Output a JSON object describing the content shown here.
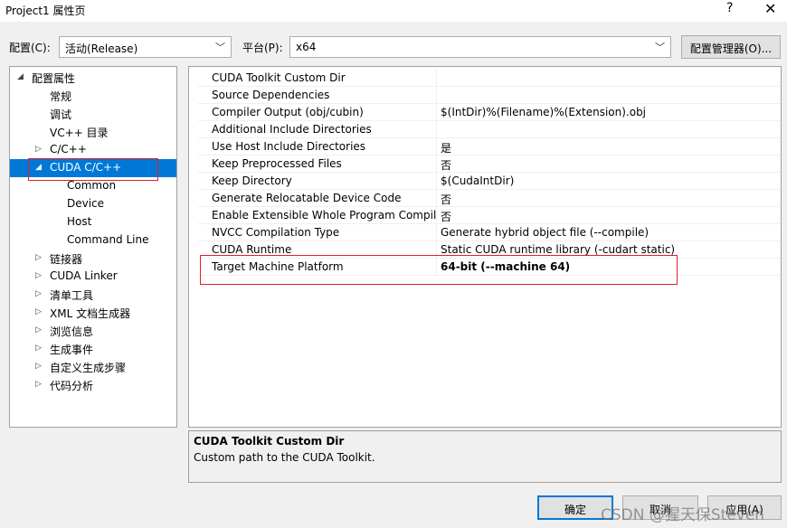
{
  "window": {
    "title": "Project1 属性页",
    "help_label": "?",
    "close_label": "✕"
  },
  "toolbar": {
    "config_label": "配置(C):",
    "config_value": "活动(Release)",
    "platform_label": "平台(P):",
    "platform_value": "x64",
    "config_manager_label": "配置管理器(O)..."
  },
  "tree": {
    "items": [
      {
        "label": "配置属性",
        "expander": "◢"
      },
      {
        "label": "常规",
        "expander": ""
      },
      {
        "label": "调试",
        "expander": ""
      },
      {
        "label": "VC++ 目录",
        "expander": ""
      },
      {
        "label": "C/C++",
        "expander": "▷"
      },
      {
        "label": "CUDA C/C++",
        "expander": "◢"
      },
      {
        "label": "Common",
        "expander": ""
      },
      {
        "label": "Device",
        "expander": ""
      },
      {
        "label": "Host",
        "expander": ""
      },
      {
        "label": "Command Line",
        "expander": ""
      },
      {
        "label": "链接器",
        "expander": "▷"
      },
      {
        "label": "CUDA Linker",
        "expander": "▷"
      },
      {
        "label": "清单工具",
        "expander": "▷"
      },
      {
        "label": "XML 文档生成器",
        "expander": "▷"
      },
      {
        "label": "浏览信息",
        "expander": "▷"
      },
      {
        "label": "生成事件",
        "expander": "▷"
      },
      {
        "label": "自定义生成步骤",
        "expander": "▷"
      },
      {
        "label": "代码分析",
        "expander": "▷"
      }
    ]
  },
  "properties": {
    "rows": [
      {
        "name": "CUDA Toolkit Custom Dir",
        "value": ""
      },
      {
        "name": "Source Dependencies",
        "value": ""
      },
      {
        "name": "Compiler Output (obj/cubin)",
        "value": "$(IntDir)%(Filename)%(Extension).obj"
      },
      {
        "name": "Additional Include Directories",
        "value": ""
      },
      {
        "name": "Use Host Include Directories",
        "value": "是"
      },
      {
        "name": "Keep Preprocessed Files",
        "value": "否"
      },
      {
        "name": "Keep Directory",
        "value": "$(CudaIntDir)"
      },
      {
        "name": "Generate Relocatable Device Code",
        "value": "否"
      },
      {
        "name": "Enable Extensible Whole Program Compila",
        "value": "否"
      },
      {
        "name": "NVCC Compilation Type",
        "value": "Generate hybrid object file (--compile)"
      },
      {
        "name": "CUDA Runtime",
        "value": "Static CUDA runtime library (-cudart static)"
      },
      {
        "name": "Target Machine Platform",
        "value": "64-bit (--machine 64)"
      }
    ]
  },
  "description": {
    "title": "CUDA Toolkit Custom Dir",
    "text": "Custom path to the CUDA Toolkit."
  },
  "footer": {
    "ok_label": "确定",
    "cancel_label": "取消",
    "apply_label": "应用(A)"
  },
  "watermark": "CSDN @猩天保Steven",
  "colors": {
    "selection": "#0078d7",
    "highlight_box": "#e0202a"
  }
}
